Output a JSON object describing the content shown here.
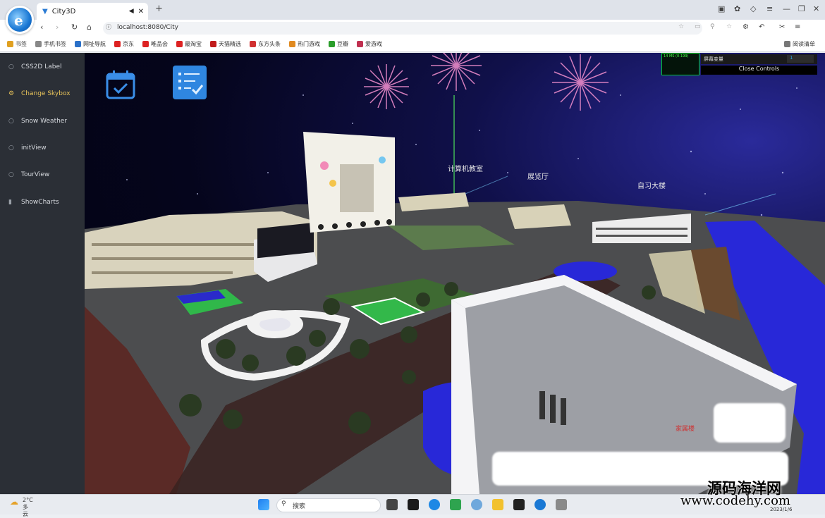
{
  "browser": {
    "tab_title": "City3D",
    "address": "localhost:8080/City",
    "bookmarks": [
      "书签",
      "手机书签",
      "网址导航",
      "京东",
      "唯品会",
      "最淘宝",
      "天猫精选",
      "东方头条",
      "热门游戏",
      "豆瓣",
      "爱游戏"
    ],
    "bookmark_colors": [
      "#e0a020",
      "#888",
      "#2a70c8",
      "#d22",
      "#d22",
      "#d22",
      "#c01a1a",
      "#d03030",
      "#e08a20",
      "#2a9d2a",
      "#c03050"
    ],
    "reading_list": "阅读清单"
  },
  "sidebar": {
    "items": [
      {
        "label": "CSS2D Label",
        "icon": "circle-icon"
      },
      {
        "label": "Change Skybox",
        "icon": "gear-icon",
        "active": true
      },
      {
        "label": "Snow Weather",
        "icon": "circle-icon"
      },
      {
        "label": "initView",
        "icon": "circle-icon"
      },
      {
        "label": "TourView",
        "icon": "circle-icon"
      },
      {
        "label": "ShowCharts",
        "icon": "bar-chart-icon"
      }
    ]
  },
  "gui": {
    "stats_text": "14 MS (0-199)",
    "row_label": "屏幕变量",
    "row_value": "1",
    "close_label": "Close Controls"
  },
  "scene_labels": [
    "计算机教室",
    "展览厅",
    "自习大楼",
    "家属楼"
  ],
  "taskbar": {
    "temp": "2°C",
    "weather": "多云",
    "search": "搜索",
    "date": "2023/1/6"
  },
  "watermark": {
    "line1": "源码海洋网",
    "line2": "www.codehy.com"
  },
  "colors": {
    "sidebar_bg": "#2b2f36",
    "active": "#e8c35a",
    "sky": "#05051c",
    "water": "#2828d8"
  }
}
